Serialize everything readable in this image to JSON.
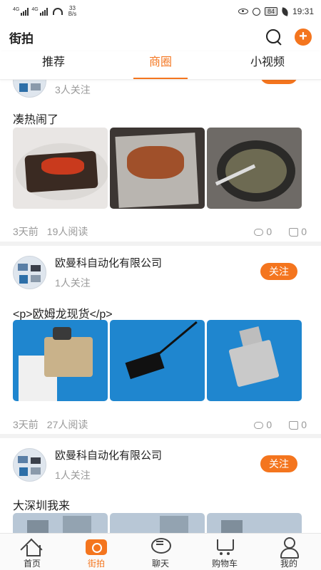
{
  "status_bar": {
    "signal1": "4G",
    "signal2": "4G",
    "speed_value": "33",
    "speed_unit": "B/s",
    "battery": "84",
    "time": "19:31"
  },
  "header": {
    "title": "街拍"
  },
  "tabs": [
    {
      "label": "推荐"
    },
    {
      "label": "商圈"
    },
    {
      "label": "小视频"
    }
  ],
  "active_tab": "商圈",
  "posts": [
    {
      "followers": "3人关注",
      "follow_label": "关注",
      "text": "凑热闹了",
      "time": "3天前",
      "reads": "19人阅读",
      "comments": "0",
      "likes": "0"
    },
    {
      "company": "欧曼科自动化有限公司",
      "followers": "1人关注",
      "follow_label": "关注",
      "text": "<p>欧姆龙现货</p>",
      "time": "3天前",
      "reads": "27人阅读",
      "comments": "0",
      "likes": "0"
    },
    {
      "company": "欧曼科自动化有限公司",
      "followers": "1人关注",
      "follow_label": "关注",
      "text": "大深圳我来"
    }
  ],
  "bottom_nav": [
    {
      "label": "首页",
      "icon": "home-icon"
    },
    {
      "label": "街拍",
      "icon": "camera-icon"
    },
    {
      "label": "聊天",
      "icon": "chat-icon"
    },
    {
      "label": "购物车",
      "icon": "cart-icon"
    },
    {
      "label": "我的",
      "icon": "user-icon"
    }
  ],
  "colors": {
    "accent": "#f4751e",
    "muted": "#999999"
  }
}
